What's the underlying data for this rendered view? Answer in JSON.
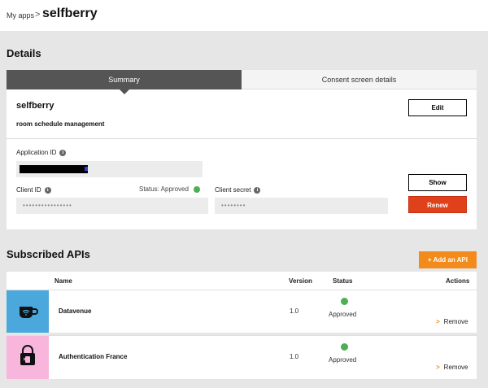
{
  "breadcrumb": {
    "parent": "My apps",
    "separator": ">",
    "current": "selfberry"
  },
  "details": {
    "section_title": "Details",
    "tabs": [
      {
        "label": "Summary",
        "active": true
      },
      {
        "label": "Consent screen details",
        "active": false
      }
    ],
    "app_name": "selfberry",
    "app_description": "room schedule management",
    "edit_label": "Edit",
    "application_id_label": "Application ID",
    "client_id_label": "Client ID",
    "client_id_value": "••••••••••••••••",
    "status_text": "Status: Approved",
    "client_secret_label": "Client secret",
    "client_secret_value": "••••••••",
    "show_label": "Show",
    "renew_label": "Renew"
  },
  "apis": {
    "section_title": "Subscribed APIs",
    "add_label": "+ Add an API",
    "columns": {
      "name": "Name",
      "version": "Version",
      "status": "Status",
      "actions": "Actions"
    },
    "rows": [
      {
        "name": "Datavenue",
        "version": "1.0",
        "status": "Approved",
        "action": "Remove",
        "logo_color": "#4aa8dc",
        "icon": "cup-wifi-icon"
      },
      {
        "name": "Authentication France",
        "version": "1.0",
        "status": "Approved",
        "action": "Remove",
        "logo_color": "#f8b6dc",
        "icon": "lock-phone-icon"
      }
    ]
  },
  "colors": {
    "accent_orange": "#f28b1c",
    "renew_red": "#e0401a",
    "status_green": "#4caf50",
    "tab_active": "#555555"
  }
}
